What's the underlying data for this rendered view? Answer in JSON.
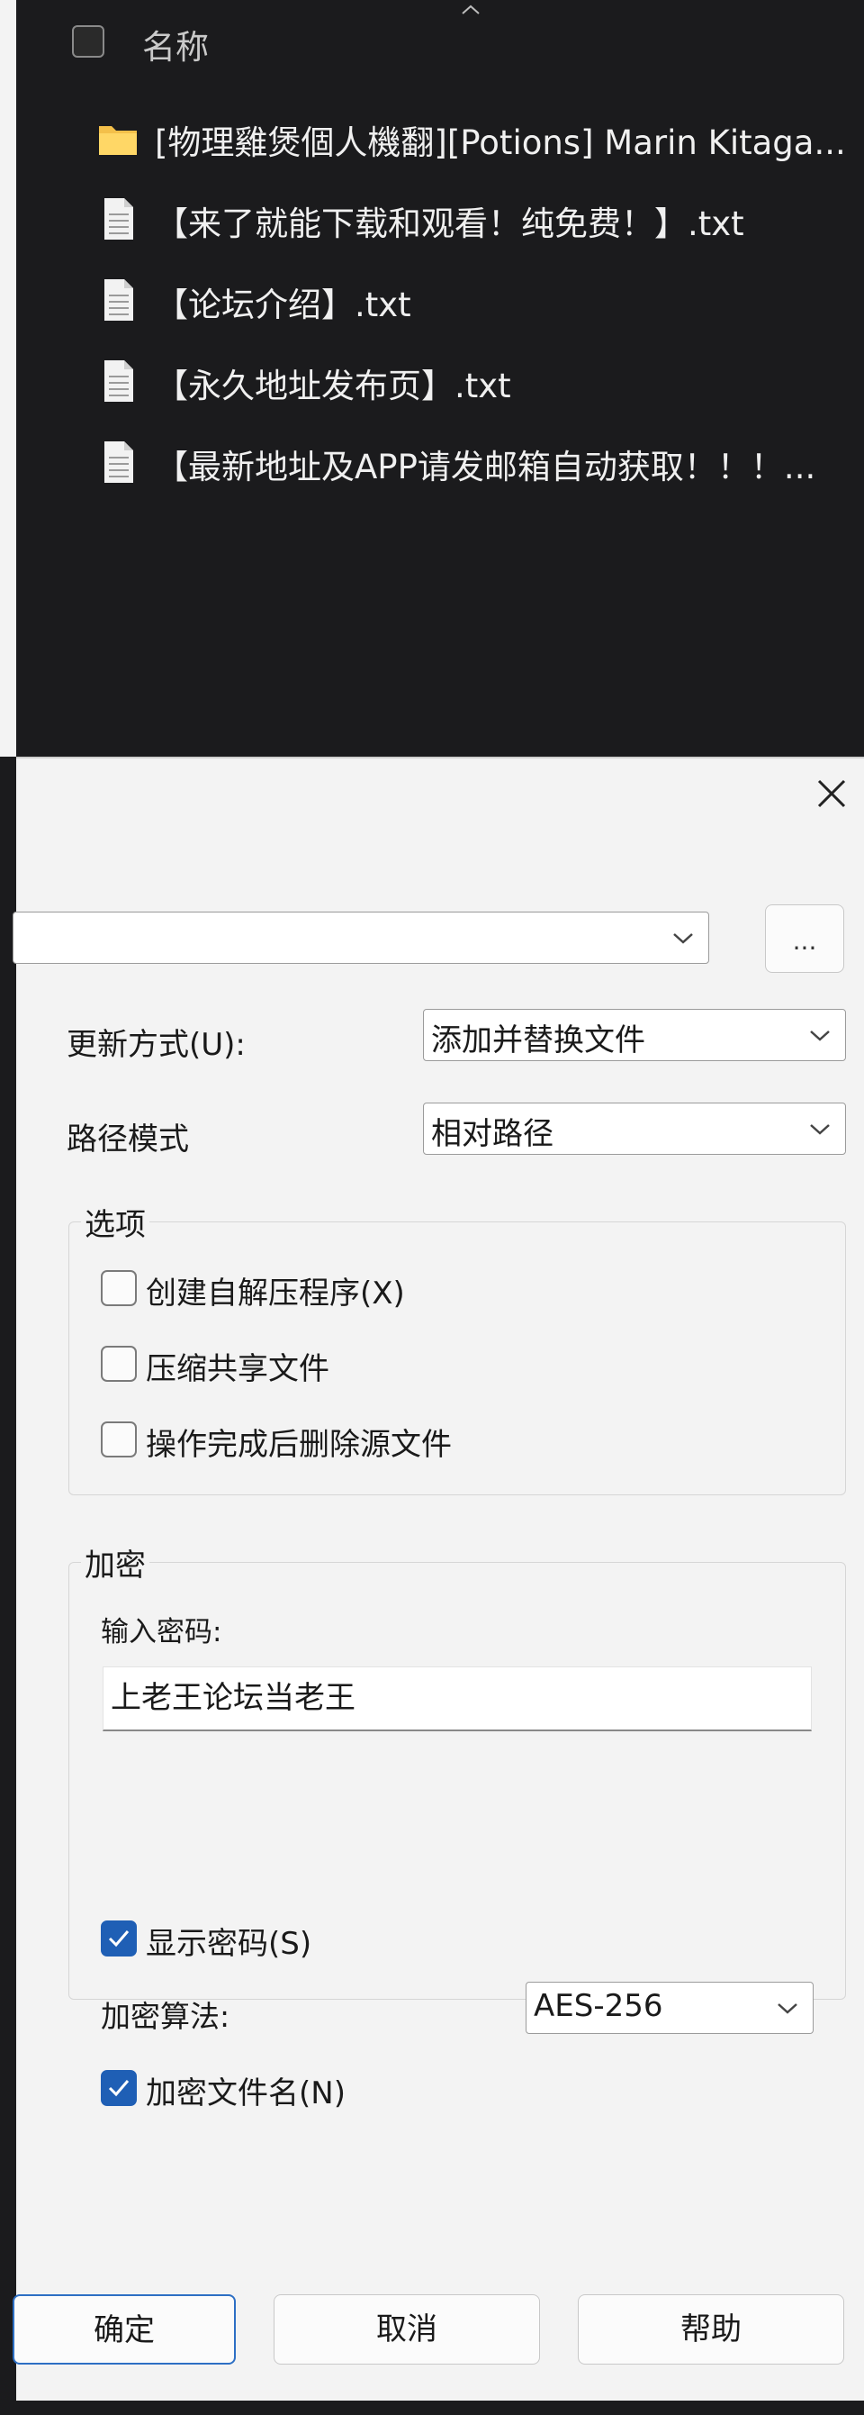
{
  "explorer": {
    "header_label": "名称",
    "files": [
      {
        "icon": "folder-icon",
        "name": "[物理雞煲個人機翻][Potions] Marin Kitaga..."
      },
      {
        "icon": "text-file-icon",
        "name": "【来了就能下载和观看！纯免费！】.txt"
      },
      {
        "icon": "text-file-icon",
        "name": "【论坛介绍】.txt"
      },
      {
        "icon": "text-file-icon",
        "name": "【永久地址发布页】.txt"
      },
      {
        "icon": "text-file-icon",
        "name": "【最新地址及APP请发邮箱自动获取！！！..."
      }
    ]
  },
  "dialog": {
    "archive_path": "",
    "browse_label": "...",
    "update_mode": {
      "label": "更新方式(U):",
      "value": "添加并替换文件"
    },
    "path_mode": {
      "label": "路径模式",
      "value": "相对路径"
    },
    "options": {
      "title": "选项",
      "items": [
        {
          "label": "创建自解压程序(X)",
          "checked": false
        },
        {
          "label": "压缩共享文件",
          "checked": false
        },
        {
          "label": "操作完成后删除源文件",
          "checked": false
        }
      ]
    },
    "encryption": {
      "title": "加密",
      "password_label": "输入密码:",
      "password_value": "上老王论坛当老王",
      "show_password": {
        "label": "显示密码(S)",
        "checked": true
      },
      "algorithm_label": "加密算法:",
      "algorithm_value": "AES-256",
      "encrypt_names": {
        "label": "加密文件名(N)",
        "checked": true
      }
    },
    "buttons": {
      "ok": "确定",
      "cancel": "取消",
      "help": "帮助"
    }
  },
  "colors": {
    "accent": "#1f5fb5",
    "dark_bg": "#1b1b1d",
    "dialog_bg": "#f3f3f3"
  }
}
